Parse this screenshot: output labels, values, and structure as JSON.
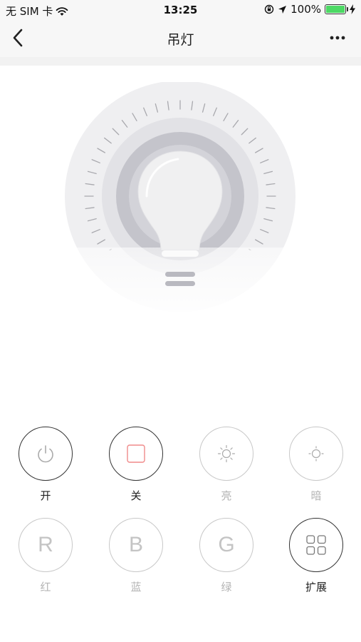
{
  "status_bar": {
    "carrier": "无 SIM 卡",
    "time": "13:25",
    "battery_percent": "100%",
    "battery_level": 1.0,
    "icons": [
      "wifi-icon",
      "lock-rotation-icon",
      "location-icon",
      "battery-icon",
      "charging-icon"
    ]
  },
  "nav": {
    "title": "吊灯",
    "back_icon": "chevron-left-icon",
    "more_icon": "more-dots-icon"
  },
  "controls": [
    {
      "label": "开",
      "icon": "power-icon",
      "active": true
    },
    {
      "label": "关",
      "icon": "stop-square-icon",
      "active": true
    },
    {
      "label": "亮",
      "icon": "brightness-up-icon",
      "active": false
    },
    {
      "label": "暗",
      "icon": "brightness-down-icon",
      "active": false
    },
    {
      "label": "红",
      "letter": "R",
      "active": false
    },
    {
      "label": "蓝",
      "letter": "B",
      "active": false
    },
    {
      "label": "绿",
      "letter": "G",
      "active": false
    },
    {
      "label": "扩展",
      "icon": "grid-icon",
      "active": true
    }
  ],
  "colors": {
    "off_square": "#f08a8a",
    "active_border": "#333333",
    "inactive_border": "#c8c8c8",
    "battery_fill": "#4cd964"
  }
}
